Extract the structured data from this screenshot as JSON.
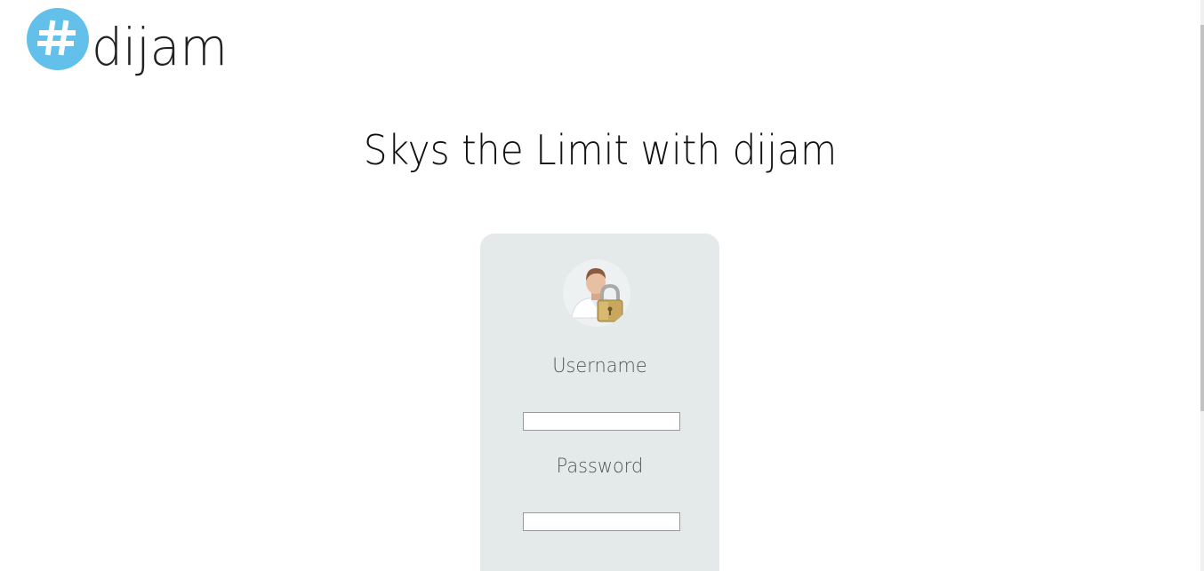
{
  "logo": {
    "icon": "hashtag-icon",
    "text": "dijam",
    "color": "#63c0ea"
  },
  "headline": "Skys the Limit with dijam",
  "login": {
    "avatar_icon": "user-lock-icon",
    "username_label": "Username",
    "username_value": "",
    "password_label": "Password",
    "password_value": ""
  },
  "colors": {
    "card_background": "#e4e9e9",
    "accent": "#63c0ea"
  }
}
